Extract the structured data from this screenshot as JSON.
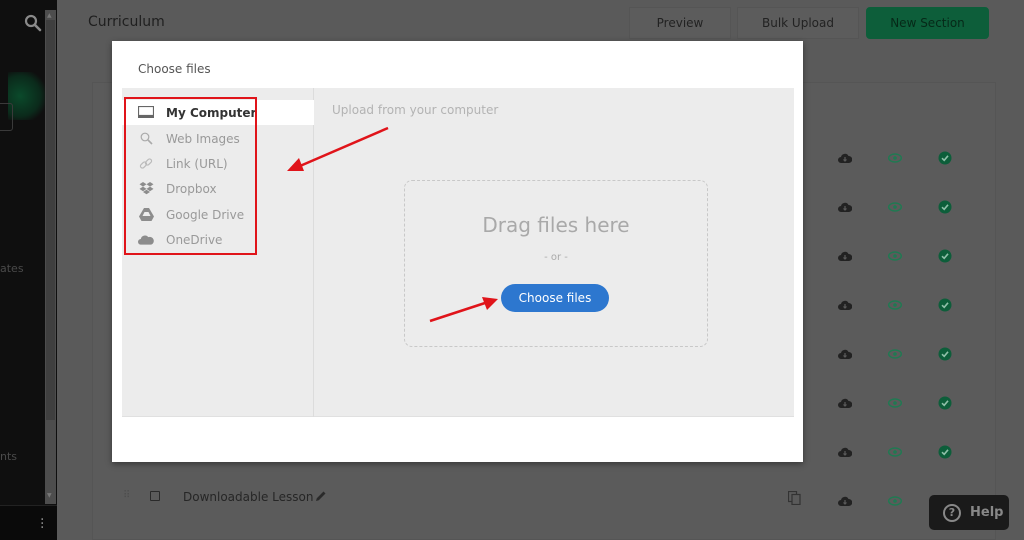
{
  "app": {
    "page_title": "Curriculum",
    "header_buttons": {
      "preview": "Preview",
      "bulk_upload": "Bulk Upload",
      "new_section": "New Section"
    },
    "sidebar": {
      "partial_labels": [
        "ates",
        "nts"
      ]
    },
    "lesson_rows": {
      "visible_name": "Downloadable Lesson",
      "row_count": 8
    },
    "help_label": "Help"
  },
  "modal": {
    "title": "Choose files",
    "sources": [
      {
        "label": "My Computer",
        "icon": "monitor-icon",
        "active": true
      },
      {
        "label": "Web Images",
        "icon": "search-icon",
        "active": false
      },
      {
        "label": "Link (URL)",
        "icon": "link-icon",
        "active": false
      },
      {
        "label": "Dropbox",
        "icon": "dropbox-icon",
        "active": false
      },
      {
        "label": "Google Drive",
        "icon": "google-drive-icon",
        "active": false
      },
      {
        "label": "OneDrive",
        "icon": "onedrive-icon",
        "active": false
      }
    ],
    "upload_hint": "Upload from your computer",
    "drag_text": "Drag files here",
    "or_text": "- or -",
    "choose_button": "Choose files"
  },
  "colors": {
    "accent_blue": "#2d77cf",
    "brand_green": "#0d5e3a",
    "annotation_red": "#e0141a"
  }
}
